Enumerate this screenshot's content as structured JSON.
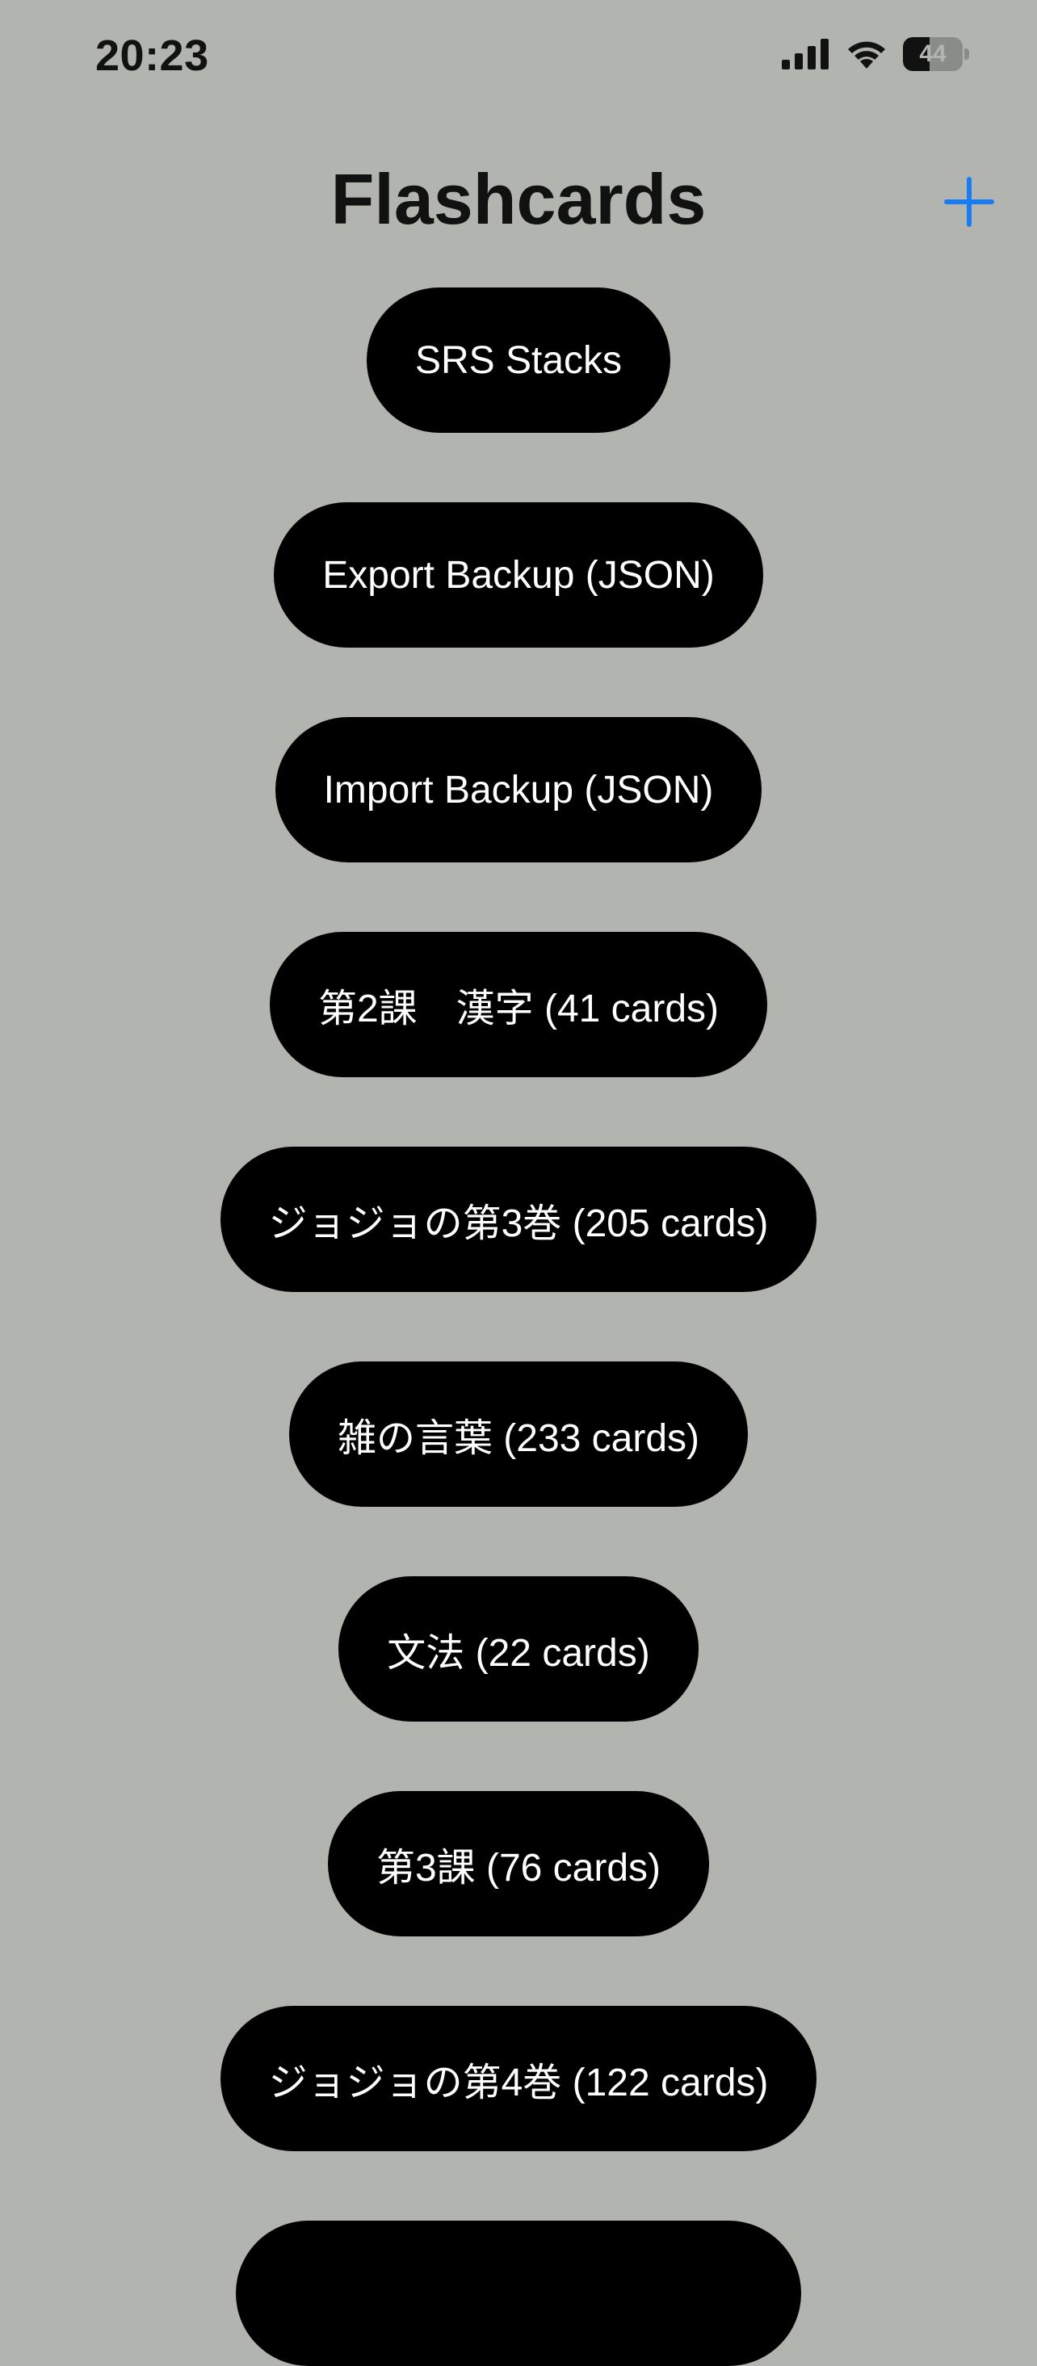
{
  "status_bar": {
    "time": "20:23",
    "battery_level": "44",
    "icons": [
      "cellular-signal-icon",
      "wifi-icon",
      "battery-icon"
    ]
  },
  "nav": {
    "title": "Flashcards",
    "add_icon": "plus-icon",
    "accent_color": "#1a7cf5"
  },
  "buttons": [
    {
      "label": "SRS Stacks"
    },
    {
      "label": "Export Backup (JSON)"
    },
    {
      "label": "Import Backup (JSON)"
    },
    {
      "label": "第2課　漢字 (41 cards)"
    },
    {
      "label": "ジョジョの第3巻 (205 cards)"
    },
    {
      "label": "雑の言葉 (233 cards)"
    },
    {
      "label": "文法 (22 cards)"
    },
    {
      "label": "第3課 (76 cards)"
    },
    {
      "label": "ジョジョの第4巻 (122 cards)"
    },
    {
      "label": ""
    }
  ],
  "colors": {
    "background": "#b2b4af",
    "button_bg": "#000000",
    "button_text": "#ffffff"
  }
}
